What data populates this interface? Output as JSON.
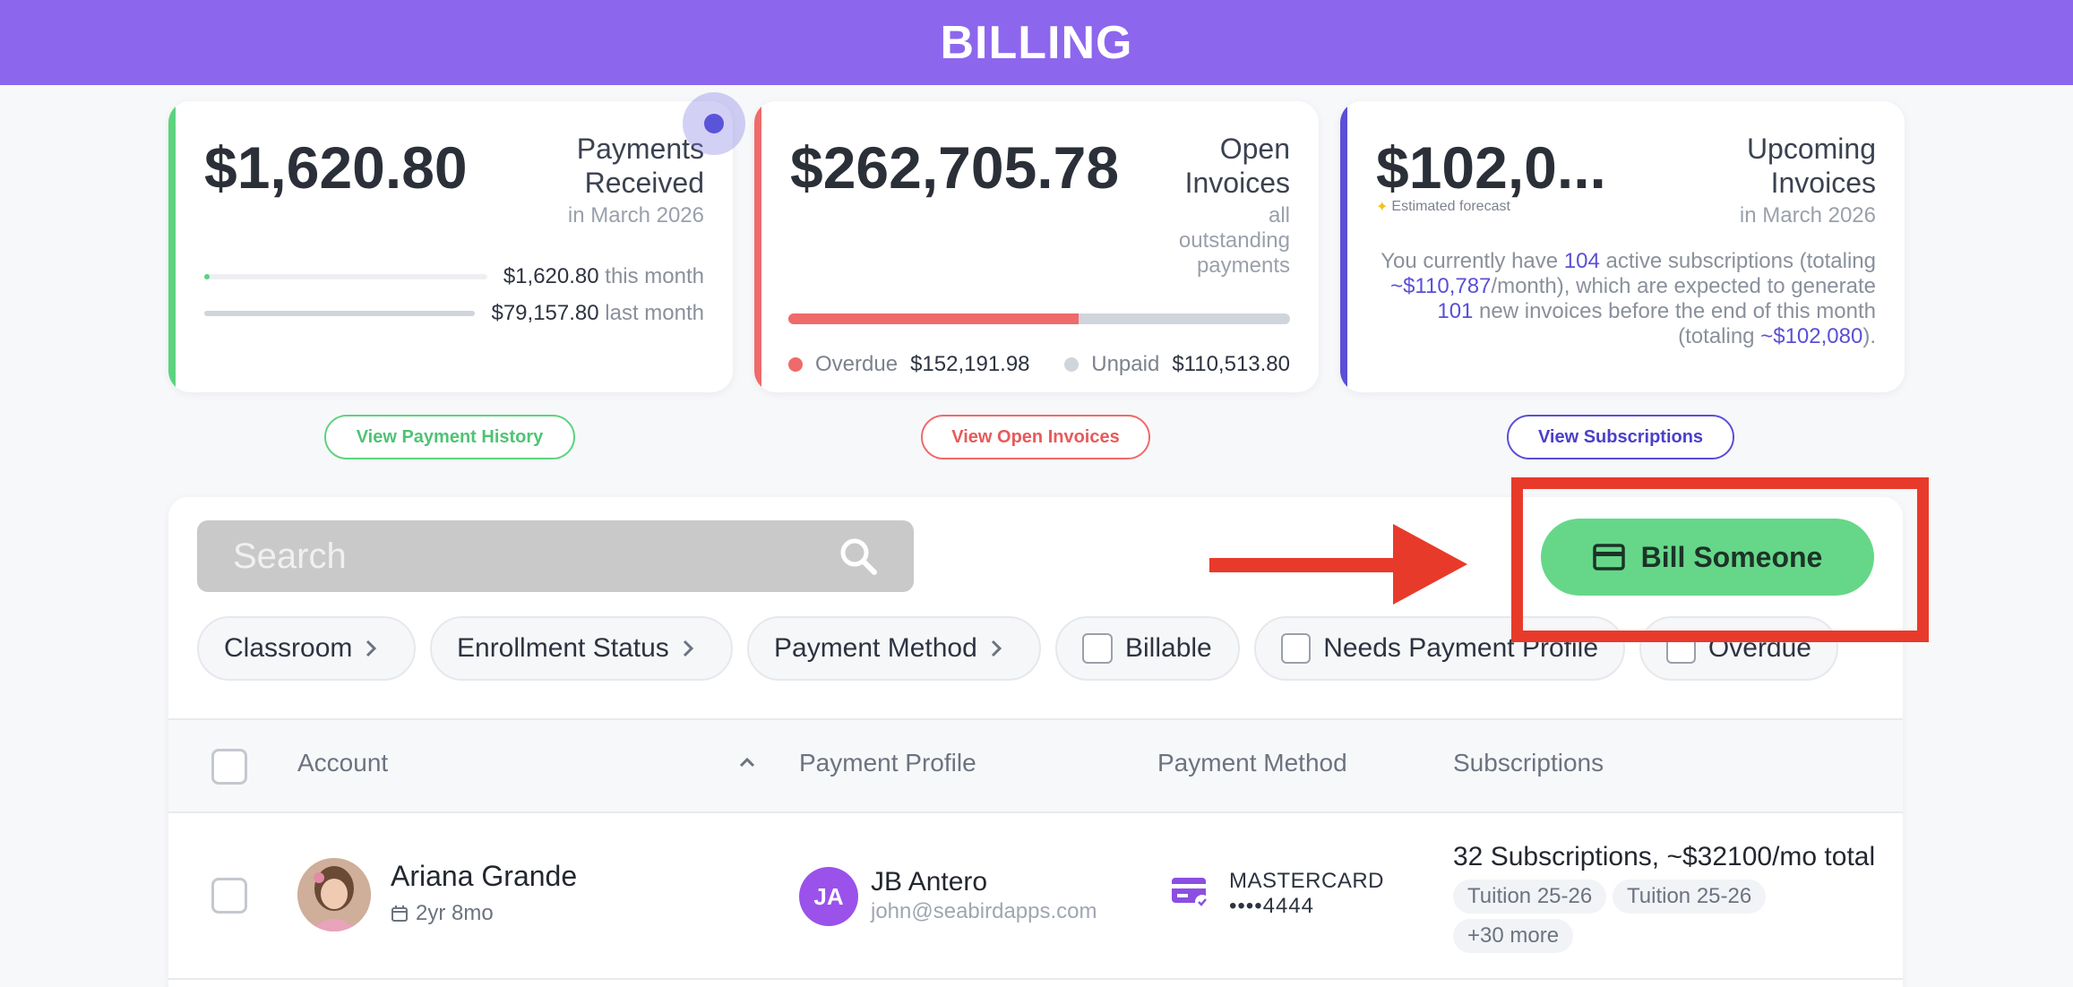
{
  "header": {
    "title": "BILLING"
  },
  "cards": {
    "received": {
      "amount": "$1,620.80",
      "label_line1": "Payments",
      "label_line2": "Received",
      "period": "in March 2026",
      "this_month_amount": "$1,620.80",
      "this_month_label": "this month",
      "last_month_amount": "$79,157.80",
      "last_month_label": "last month",
      "this_month_fraction": 0.02,
      "last_month_fraction": 1.0,
      "accent": "#5dd37f",
      "button": "View Payment History"
    },
    "open": {
      "amount": "$262,705.78",
      "label_line1": "Open",
      "label_line2": "Invoices",
      "sub_line1": "all",
      "sub_line2": "outstanding",
      "sub_line3": "payments",
      "overdue_label": "Overdue",
      "overdue_amount": "$152,191.98",
      "unpaid_label": "Unpaid",
      "unpaid_amount": "$110,513.80",
      "overdue_fraction": 0.579,
      "accent": "#ef6a6a",
      "button": "View Open Invoices"
    },
    "upcoming": {
      "amount": "$102,0...",
      "forecast": "Estimated forecast",
      "label_line1": "Upcoming",
      "label_line2": "Invoices",
      "period": "in March 2026",
      "text_1": "You currently have ",
      "active_count": "104",
      "text_2": " active subscriptions (totaling ",
      "monthly_total": "~$110,787",
      "text_3": "/month), which are expected to generate ",
      "invoice_count": "101",
      "text_4": " new invoices before the end of this month (totaling ",
      "forecast_total": "~$102,080",
      "text_5": ").",
      "accent": "#5a4fd6",
      "button": "View Subscriptions"
    }
  },
  "toolbar": {
    "search_placeholder": "Search",
    "bill_button": "Bill Someone",
    "bill_color": "#66d789",
    "highlight_color": "#e83a2a"
  },
  "filters": [
    {
      "label": "Classroom",
      "type": "dropdown"
    },
    {
      "label": "Enrollment Status",
      "type": "dropdown"
    },
    {
      "label": "Payment Method",
      "type": "dropdown"
    },
    {
      "label": "Billable",
      "type": "checkbox"
    },
    {
      "label": "Needs Payment Profile",
      "type": "checkbox"
    },
    {
      "label": "Overdue",
      "type": "checkbox"
    }
  ],
  "table": {
    "headers": {
      "account": "Account",
      "payment_profile": "Payment Profile",
      "payment_method": "Payment Method",
      "subscriptions": "Subscriptions"
    },
    "rows": [
      {
        "name": "Ariana Grande",
        "age": "2yr 8mo",
        "profile_initials": "JA",
        "profile_name": "JB Antero",
        "profile_email": "john@seabirdapps.com",
        "card_brand": "MASTERCARD",
        "card_last4": "••••4444",
        "subscriptions_summary": "32 Subscriptions, ~$32100/mo total",
        "tags": [
          "Tuition 25-26",
          "Tuition 25-26",
          "+30 more"
        ]
      }
    ]
  }
}
